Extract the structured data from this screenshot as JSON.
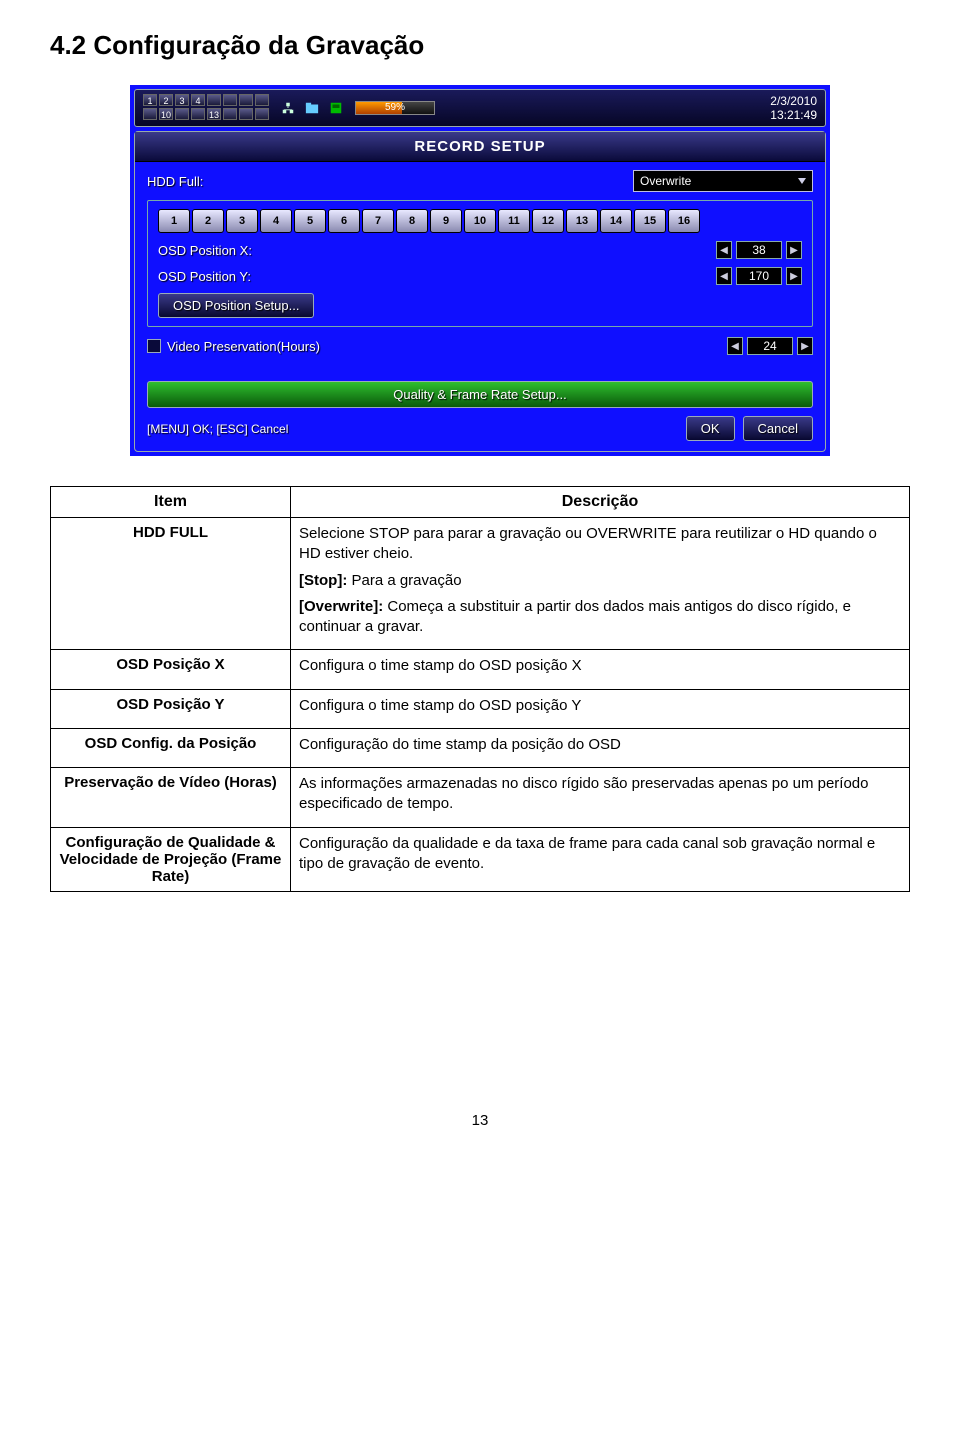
{
  "section_title": "4.2 Configuração da Gravação",
  "status_bar": {
    "row1": [
      "1",
      "2",
      "3",
      "4",
      "",
      "",
      "",
      ""
    ],
    "row2": [
      "",
      "10",
      "",
      "",
      "13",
      "",
      "",
      ""
    ],
    "progress_pct": "59%",
    "progress_fill_pct": 59,
    "date": "2/3/2010",
    "time": "13:21:49"
  },
  "panel": {
    "title": "RECORD SETUP",
    "hdd_full_label": "HDD Full:",
    "hdd_full_value": "Overwrite",
    "channels": [
      "1",
      "2",
      "3",
      "4",
      "5",
      "6",
      "7",
      "8",
      "9",
      "10",
      "11",
      "12",
      "13",
      "14",
      "15",
      "16"
    ],
    "osd_x_label": "OSD Position X:",
    "osd_x_value": "38",
    "osd_y_label": "OSD Position Y:",
    "osd_y_value": "170",
    "osd_setup_btn": "OSD Position Setup...",
    "video_pres_label": "Video Preservation(Hours)",
    "video_pres_value": "24",
    "quality_btn": "Quality & Frame Rate Setup...",
    "hint": "[MENU] OK; [ESC] Cancel",
    "ok_btn": "OK",
    "cancel_btn": "Cancel"
  },
  "table": {
    "head_item": "Item",
    "head_desc": "Descrição",
    "rows": [
      {
        "item": "HDD FULL",
        "desc": [
          "Selecione STOP para parar a gravação ou OVERWRITE para reutilizar o HD quando o HD estiver cheio.",
          "[Stop]: Para a gravação",
          "[Overwrite]: Começa a substituir a partir dos dados mais antigos do disco rígido, e continuar a gravar."
        ]
      },
      {
        "item": "OSD Posição X",
        "desc": [
          "Configura o time stamp do OSD posição X"
        ]
      },
      {
        "item": "OSD Posição Y",
        "desc": [
          "Configura o time stamp do OSD posição Y"
        ]
      },
      {
        "item": "OSD Config. da Posição",
        "desc": [
          "Configuração do time stamp da posição do OSD"
        ]
      },
      {
        "item": "Preservação de Vídeo (Horas)",
        "desc": [
          "As informações armazenadas no disco rígido são preservadas apenas po um período especificado de tempo."
        ]
      },
      {
        "item": "Configuração de Qualidade & Velocidade de Projeção (Frame Rate)",
        "desc": [
          "Configuração da qualidade e da taxa de frame para cada canal sob gravação normal e tipo de gravação de evento."
        ]
      }
    ]
  },
  "page_number": "13"
}
